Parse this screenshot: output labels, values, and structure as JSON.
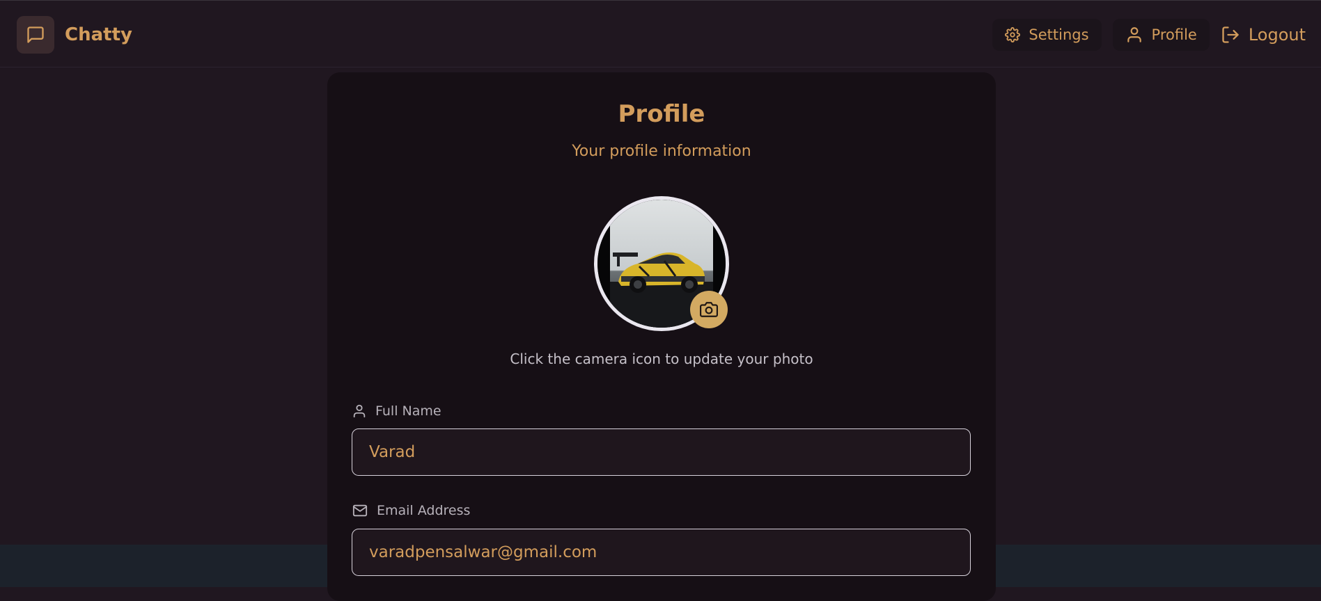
{
  "header": {
    "app_name": "Chatty",
    "logo_icon": "message-square-icon",
    "nav": {
      "settings_label": "Settings",
      "profile_label": "Profile",
      "logout_label": "Logout"
    }
  },
  "profile": {
    "title": "Profile",
    "subtitle": "Your profile information",
    "avatar_hint": "Click the camera icon to update your photo",
    "full_name": {
      "label": "Full Name",
      "value": "Varad",
      "icon": "user-icon"
    },
    "email": {
      "label": "Email Address",
      "value": "varadpensalwar@gmail.com",
      "icon": "mail-icon"
    }
  },
  "colors": {
    "accent": "#d39d5c",
    "background": "#201720",
    "card": "#160f15",
    "camera_button": "#d3aa62"
  }
}
